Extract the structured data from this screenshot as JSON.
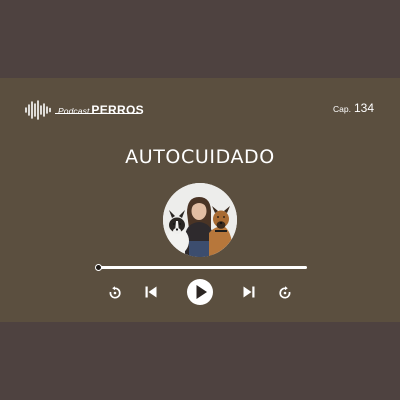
{
  "brand": {
    "small_label": "Podcast",
    "big_label": "PERROS"
  },
  "episode": {
    "label": "Cap.",
    "number": "134"
  },
  "title": "AUTOCUIDADO",
  "player": {
    "progress": 0,
    "controls": [
      {
        "name": "replay-button",
        "icon": "rewind-icon"
      },
      {
        "name": "previous-button",
        "icon": "skip-previous-icon"
      },
      {
        "name": "play-button",
        "icon": "play-icon"
      },
      {
        "name": "next-button",
        "icon": "skip-next-icon"
      },
      {
        "name": "forward-button",
        "icon": "fast-forward-icon"
      }
    ]
  },
  "colors": {
    "background": "#4e4240",
    "band": "#5b4f3f",
    "foreground": "#ffffff"
  }
}
